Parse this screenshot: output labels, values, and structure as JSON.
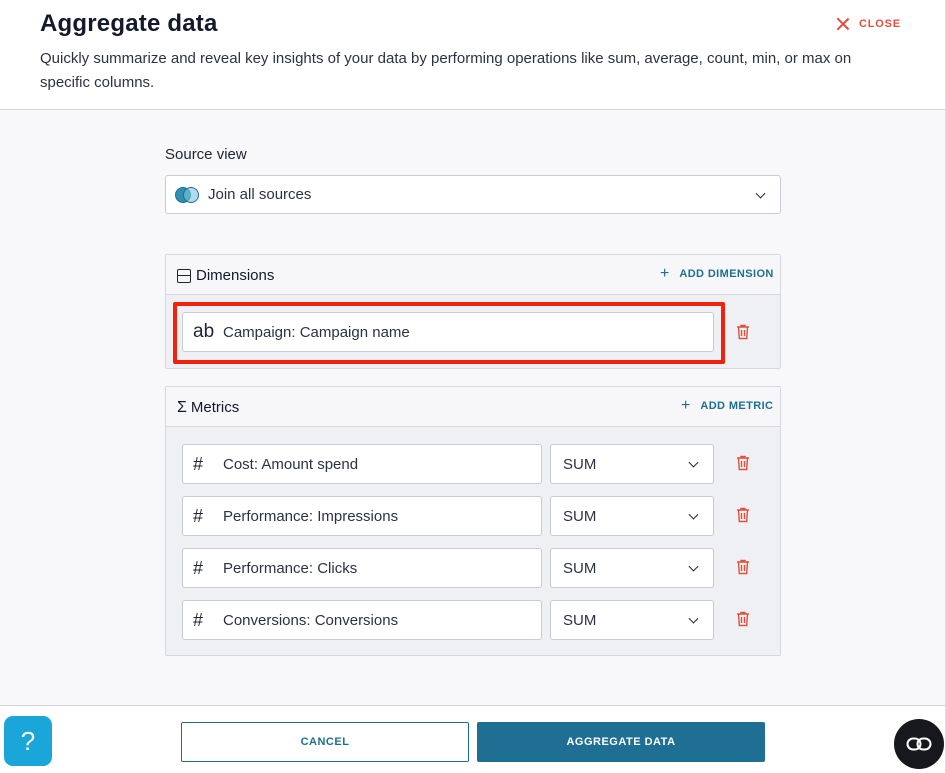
{
  "header": {
    "title": "Aggregate data",
    "subtitle": "Quickly summarize and reveal key insights of your data by performing operations like sum, average, count, min, or max on specific columns.",
    "close_label": "CLOSE"
  },
  "source": {
    "label": "Source view",
    "selected": "Join all sources",
    "icon": "join-sources-icon"
  },
  "dimensions": {
    "title": "Dimensions",
    "add_label": "ADD DIMENSION",
    "items": [
      {
        "type_icon": "ab",
        "value": "Campaign: Campaign name"
      }
    ]
  },
  "metrics": {
    "title": "Metrics",
    "add_label": "ADD METRIC",
    "items": [
      {
        "type_icon": "#",
        "value": "Cost: Amount spend",
        "aggregation": "SUM"
      },
      {
        "type_icon": "#",
        "value": "Performance: Impressions",
        "aggregation": "SUM"
      },
      {
        "type_icon": "#",
        "value": "Performance: Clicks",
        "aggregation": "SUM"
      },
      {
        "type_icon": "#",
        "value": "Conversions: Conversions",
        "aggregation": "SUM"
      }
    ]
  },
  "footer": {
    "cancel_label": "CANCEL",
    "submit_label": "AGGREGATE DATA"
  },
  "widgets": {
    "help_label": "?"
  },
  "colors": {
    "accent": "#1e6f93",
    "danger": "#e0503f",
    "highlight": "#f2200f",
    "help_bg": "#1aa6d9"
  }
}
